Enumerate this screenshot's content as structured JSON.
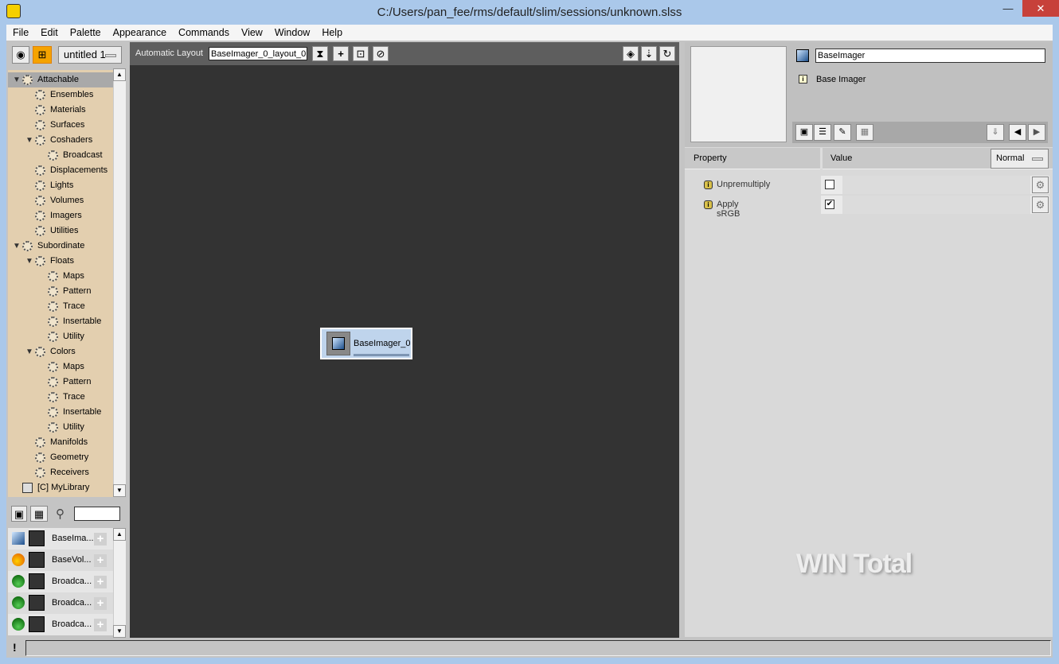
{
  "window": {
    "title": "C:/Users/pan_fee/rms/default/slim/sessions/unknown.slss"
  },
  "menu": [
    "File",
    "Edit",
    "Palette",
    "Appearance",
    "Commands",
    "View",
    "Window",
    "Help"
  ],
  "palette": {
    "selector": "untitled 1"
  },
  "tree": [
    {
      "label": "Attachable",
      "level": 0,
      "expanded": true,
      "selected": true
    },
    {
      "label": "Ensembles",
      "level": 1
    },
    {
      "label": "Materials",
      "level": 1
    },
    {
      "label": "Surfaces",
      "level": 1
    },
    {
      "label": "Coshaders",
      "level": 1,
      "expanded": true
    },
    {
      "label": "Broadcast",
      "level": 2
    },
    {
      "label": "Displacements",
      "level": 1
    },
    {
      "label": "Lights",
      "level": 1
    },
    {
      "label": "Volumes",
      "level": 1
    },
    {
      "label": "Imagers",
      "level": 1
    },
    {
      "label": "Utilities",
      "level": 1
    },
    {
      "label": "Subordinate",
      "level": 0,
      "expanded": true
    },
    {
      "label": "Floats",
      "level": 1,
      "expanded": true
    },
    {
      "label": "Maps",
      "level": 2
    },
    {
      "label": "Pattern",
      "level": 2
    },
    {
      "label": "Trace",
      "level": 2
    },
    {
      "label": "Insertable",
      "level": 2
    },
    {
      "label": "Utility",
      "level": 2
    },
    {
      "label": "Colors",
      "level": 1,
      "expanded": true
    },
    {
      "label": "Maps",
      "level": 2
    },
    {
      "label": "Pattern",
      "level": 2
    },
    {
      "label": "Trace",
      "level": 2
    },
    {
      "label": "Insertable",
      "level": 2
    },
    {
      "label": "Utility",
      "level": 2
    },
    {
      "label": "Manifolds",
      "level": 1
    },
    {
      "label": "Geometry",
      "level": 1
    },
    {
      "label": "Receivers",
      "level": 1
    },
    {
      "label": "[C] MyLibrary",
      "level": 0,
      "library": true
    }
  ],
  "search": {
    "value": ""
  },
  "instances": [
    {
      "label": "BaseIma...",
      "icon": "imager-icon"
    },
    {
      "label": "BaseVol...",
      "icon": "volume-icon"
    },
    {
      "label": "Broadca...",
      "icon": "broadcast-icon"
    },
    {
      "label": "Broadca...",
      "icon": "broadcast-icon"
    },
    {
      "label": "Broadca...",
      "icon": "broadcast-icon"
    }
  ],
  "layout": {
    "label": "Automatic Layout",
    "name": "BaseImager_0_layout_0"
  },
  "node": {
    "label": "BaseImager_0"
  },
  "inspector": {
    "name": "BaseImager",
    "description": "Base Imager",
    "col_property": "Property",
    "col_value": "Value",
    "mode": "Normal",
    "properties": [
      {
        "label": "Unpremultiply",
        "checked": false
      },
      {
        "label": "Apply sRGB",
        "checked": true
      }
    ]
  },
  "watermark": "WIN Total",
  "status": {
    "icon": "!",
    "text": ""
  }
}
